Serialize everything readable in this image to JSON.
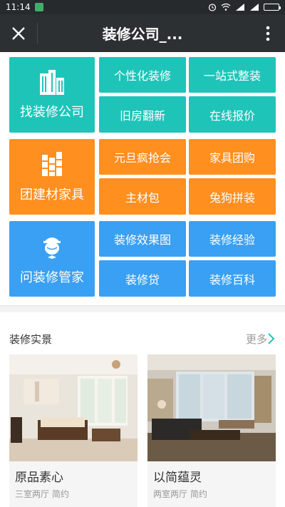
{
  "status_bar": {
    "time": "11:14"
  },
  "header": {
    "title": "装修公司_..."
  },
  "grid": {
    "find_company": "找装修公司",
    "personalized": "个性化装修",
    "one_stop": "一站式整装",
    "old_house": "旧房翻新",
    "online_quote": "在线报价",
    "group_buy_materials": "团建材家具",
    "new_year_sale": "元旦疯抢会",
    "furniture_group": "家具团购",
    "main_materials": "主材包",
    "diy_group": "兔狗拼装",
    "ask_butler": "问装修管家",
    "effect_images": "装修效果图",
    "experience": "装修经验",
    "loan": "装修贷",
    "encyclopedia": "装修百科"
  },
  "section": {
    "title": "装修实景",
    "more_label": "更多"
  },
  "cards": [
    {
      "title": "原品素心",
      "subtitle": "三室两厅 简约"
    },
    {
      "title": "以简蕴灵",
      "subtitle": "两室两厅 简约"
    }
  ],
  "colors": {
    "teal": "#1fc4b9",
    "orange": "#ff8f1f",
    "blue": "#3aa0f3"
  }
}
